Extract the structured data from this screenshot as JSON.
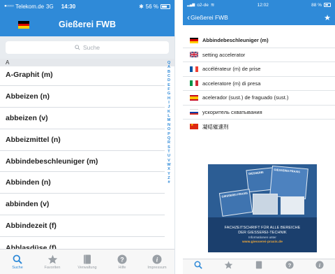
{
  "left": {
    "status": {
      "carrier": "Telekom.de",
      "network": "3G",
      "time": "14:30",
      "battery": "56 %"
    },
    "title": "Gießerei FWB",
    "search_placeholder": "Suche",
    "section_letter": "A",
    "words": [
      "A-Graphit (m)",
      "Abbeizen (n)",
      "abbeizen (v)",
      "Abbeizmittel (n)",
      "Abbindebeschleuniger (m)",
      "Abbinden (n)",
      "abbinden (v)",
      "Abbindezeit (f)",
      "Abblasdüse (f)"
    ],
    "alphabet": [
      "Q",
      "A",
      "B",
      "C",
      "D",
      "E",
      "F",
      "G",
      "H",
      "I",
      "J",
      "K",
      "L",
      "M",
      "N",
      "O",
      "P",
      "Q",
      "R",
      "S",
      "T",
      "U",
      "V",
      "W",
      "X",
      "Y",
      "Z",
      "#"
    ],
    "tabs": [
      {
        "label": "Suche",
        "icon": "search-icon"
      },
      {
        "label": "Favoriten",
        "icon": "star-icon"
      },
      {
        "label": "Verwaltung",
        "icon": "book-icon"
      },
      {
        "label": "Hilfe",
        "icon": "help-icon"
      },
      {
        "label": "Impressum",
        "icon": "info-icon"
      }
    ]
  },
  "right": {
    "status": {
      "carrier": "o2-de",
      "time": "12:02",
      "battery": "88 %"
    },
    "back_label": "Gießerei FWB",
    "translations": [
      {
        "lang": "de",
        "text": "Abbindebeschleuniger (m)"
      },
      {
        "lang": "en",
        "text": "setting accelerator"
      },
      {
        "lang": "fr",
        "text": "accélérateur (m) de prise"
      },
      {
        "lang": "it",
        "text": "acceleratore (m) di presa"
      },
      {
        "lang": "es",
        "text": "acelerador (sust.) de fraguado (sust.)"
      },
      {
        "lang": "ru",
        "text": "ускоритель схватывания"
      },
      {
        "lang": "cn",
        "text": "凝结催速剂"
      }
    ],
    "ad": {
      "mag_title": "GIESSEREI",
      "mag_title2": "GIESSEREI PRAXIS",
      "mag_title3": "GIESSEREI PRAXIS",
      "line1": "FACHZEITSCHRIFT FÜR ALLE BEREICHE",
      "line2": "DER GIESSEREI-TECHNIK",
      "line3": "Informationen unter",
      "url": "www.giesserei-praxis.de"
    },
    "tabs": [
      {
        "icon": "search-icon"
      },
      {
        "icon": "star-icon"
      },
      {
        "icon": "book-icon"
      },
      {
        "icon": "help-icon"
      },
      {
        "icon": "info-icon"
      }
    ]
  },
  "colors": {
    "accent": "#2f8ad8",
    "list_text": "#1f1f1f",
    "separator": "#d9dde2"
  }
}
